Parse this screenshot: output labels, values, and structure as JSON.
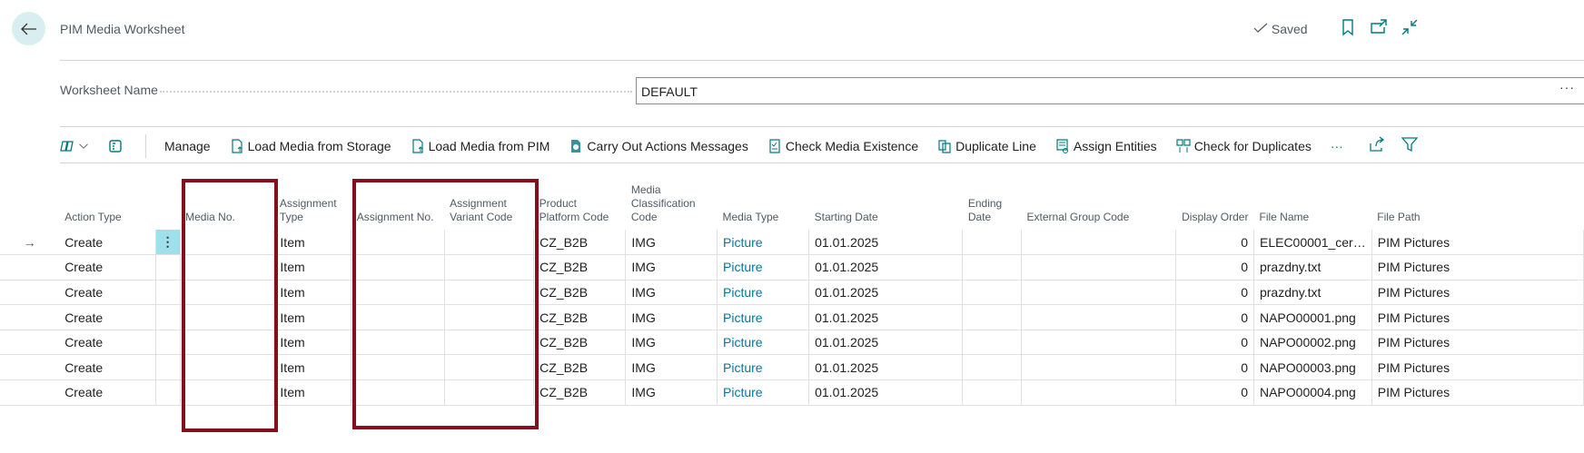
{
  "header": {
    "title": "PIM Media Worksheet",
    "status": "Saved"
  },
  "worksheet": {
    "label": "Worksheet Name",
    "value": "DEFAULT",
    "more": "···"
  },
  "toolbar": {
    "items": [
      "Manage",
      "Load Media from Storage",
      "Load Media from PIM",
      "Carry Out Actions Messages",
      "Check Media Existence",
      "Duplicate Line",
      "Assign Entities",
      "Check for Duplicates"
    ],
    "more": "···"
  },
  "table": {
    "columns": [
      "Action Type",
      "Media No.",
      "Assignment Type",
      "Assignment No.",
      "Assignment Variant Code",
      "Product Platform Code",
      "Media Classification Code",
      "Media Type",
      "Starting Date",
      "Ending Date",
      "External Group Code",
      "Display Order",
      "File Name",
      "File Path"
    ],
    "rows": [
      [
        "Create",
        "",
        "Item",
        "",
        "",
        "CZ_B2B",
        "IMG",
        "Picture",
        "01.01.2025",
        "",
        "",
        "0",
        "ELEC00001_cer…",
        "PIM Pictures"
      ],
      [
        "Create",
        "",
        "Item",
        "",
        "",
        "CZ_B2B",
        "IMG",
        "Picture",
        "01.01.2025",
        "",
        "",
        "0",
        "prazdny.txt",
        "PIM Pictures"
      ],
      [
        "Create",
        "",
        "Item",
        "",
        "",
        "CZ_B2B",
        "IMG",
        "Picture",
        "01.01.2025",
        "",
        "",
        "0",
        "prazdny.txt",
        "PIM Pictures"
      ],
      [
        "Create",
        "",
        "Item",
        "",
        "",
        "CZ_B2B",
        "IMG",
        "Picture",
        "01.01.2025",
        "",
        "",
        "0",
        "NAPO00001.png",
        "PIM Pictures"
      ],
      [
        "Create",
        "",
        "Item",
        "",
        "",
        "CZ_B2B",
        "IMG",
        "Picture",
        "01.01.2025",
        "",
        "",
        "0",
        "NAPO00002.png",
        "PIM Pictures"
      ],
      [
        "Create",
        "",
        "Item",
        "",
        "",
        "CZ_B2B",
        "IMG",
        "Picture",
        "01.01.2025",
        "",
        "",
        "0",
        "NAPO00003.png",
        "PIM Pictures"
      ],
      [
        "Create",
        "",
        "Item",
        "",
        "",
        "CZ_B2B",
        "IMG",
        "Picture",
        "01.01.2025",
        "",
        "",
        "0",
        "NAPO00004.png",
        "PIM Pictures"
      ]
    ]
  },
  "colors": {
    "accent": "#00799b",
    "highlight": "#860f1c"
  }
}
